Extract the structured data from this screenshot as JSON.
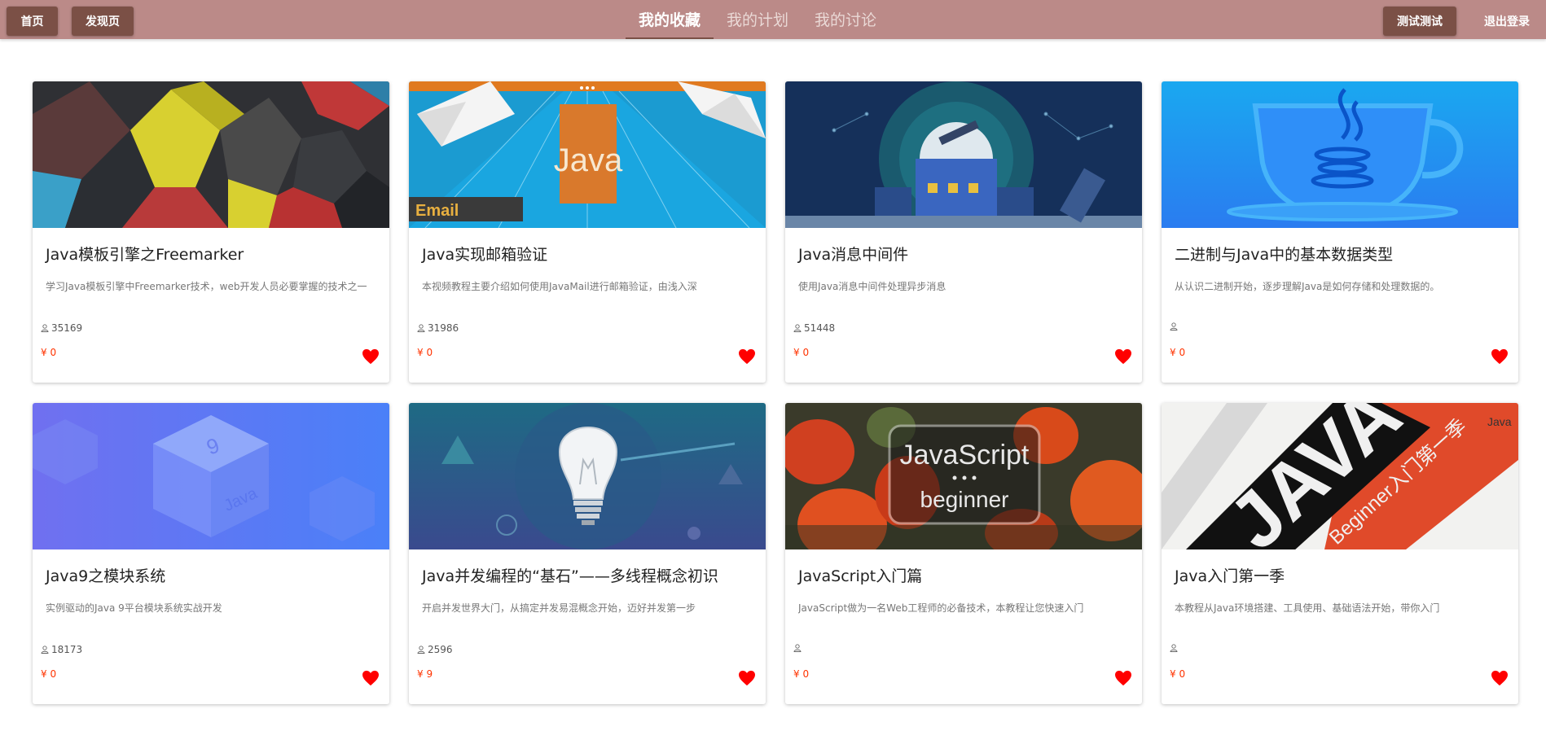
{
  "nav": {
    "home": "首页",
    "discover": "发现页",
    "tabs": [
      {
        "label": "我的收藏",
        "active": true
      },
      {
        "label": "我的计划",
        "active": false
      },
      {
        "label": "我的讨论",
        "active": false
      }
    ],
    "user": "测试测试",
    "logout": "退出登录"
  },
  "colors": {
    "topbar": "#bb8a88",
    "button": "#7b5046",
    "price": "#ff3300",
    "heart": "#ff0000"
  },
  "courses": [
    {
      "title": "Java模板引擎之Freemarker",
      "desc": "学习Java模板引擎中Freemarker技术，web开发人员必要掌握的技术之一",
      "views": "35169",
      "price": "¥ 0",
      "thumb": "abstract-blocks"
    },
    {
      "title": "Java实现邮箱验证",
      "desc": "本视频教程主要介绍如何使用JavaMail进行邮箱验证，由浅入深",
      "views": "31986",
      "price": "¥ 0",
      "thumb": "java-email",
      "thumb_text": [
        "Java",
        "Email"
      ]
    },
    {
      "title": "Java消息中间件",
      "desc": "使用Java消息中间件处理异步消息",
      "views": "51448",
      "price": "¥ 0",
      "thumb": "observatory"
    },
    {
      "title": "二进制与Java中的基本数据类型",
      "desc": "从认识二进制开始，逐步理解Java是如何存储和处理数据的。",
      "views": "",
      "price": "¥ 0",
      "thumb": "java-cup"
    },
    {
      "title": "Java9之模块系统",
      "desc": "实例驱动的Java 9平台模块系统实战开发",
      "views": "18173",
      "price": "¥ 0",
      "thumb": "java9-cube",
      "thumb_text": [
        "9",
        "Java"
      ]
    },
    {
      "title": "Java并发编程的“基石”——多线程概念初识",
      "desc": "开启并发世界大门，从搞定并发易混概念开始，迈好并发第一步",
      "views": "2596",
      "price": "¥ 9",
      "thumb": "lightbulb"
    },
    {
      "title": "JavaScript入门篇",
      "desc": "JavaScript做为一名Web工程师的必备技术，本教程让您快速入门",
      "views": "",
      "price": "¥ 0",
      "thumb": "javascript-tulips",
      "thumb_text": [
        "JavaScript",
        "beginner"
      ]
    },
    {
      "title": "Java入门第一季",
      "desc": "本教程从Java环境搭建、工具使用、基础语法开始，带你入门",
      "views": "",
      "price": "¥ 0",
      "thumb": "java-beginner",
      "thumb_text": [
        "JAVA",
        "Beginner入门第一季",
        "Java"
      ]
    }
  ]
}
